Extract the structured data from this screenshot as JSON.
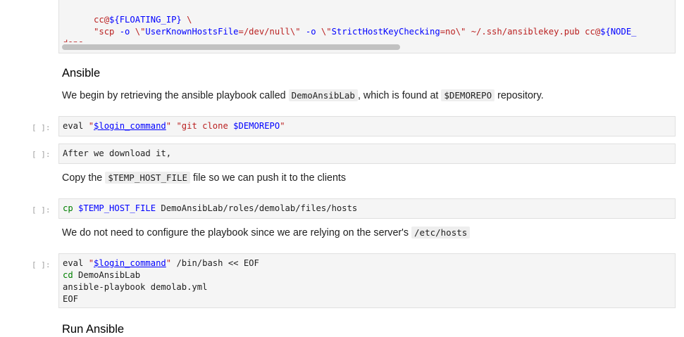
{
  "top_cell": {
    "line1_indent": "      ",
    "line1_user": "cc@",
    "line1_var": "${FLOATING_IP}",
    "line1_tail": " \\",
    "line2_indent": "      ",
    "line2_q1": "\"scp ",
    "line2_opt1": "-o",
    "line2_s1": " \\\"",
    "line2_key1": "UserKnownHostsFile",
    "line2_s2": "=/dev/null\\\" ",
    "line2_opt2": "-o",
    "line2_s3": " \\\"",
    "line2_key2": "StrictHostKeyChecking",
    "line2_s4": "=no\\\" ~/.ssh/ansiblekey.pub ",
    "line2_user": "cc@",
    "line2_var": "${NODE_",
    "line3": "done"
  },
  "ansible_heading": "Ansible",
  "ansible_text": {
    "part1": "We begin by retrieving the ansible playbook called ",
    "code1": "DemoAnsibLab",
    "part2": ", which is found at ",
    "code2": "$DEMOREPO",
    "part3": " repository."
  },
  "cell_git": {
    "prompt": "[ ]:",
    "eval": "eval ",
    "str1": "\"",
    "var1": "$login_command",
    "str2": "\"",
    "str3": " \"git clone ",
    "var2": "$DEMOREPO",
    "str4": "\""
  },
  "cell_download": {
    "prompt": "[ ]:",
    "text": "After we download it,"
  },
  "copy_text": {
    "part1": "Copy the ",
    "code1": "$TEMP_HOST_FILE",
    "part2": " file so we can push it to the clients"
  },
  "cell_cp": {
    "prompt": "[ ]:",
    "cmd": "cp",
    "var": " $TEMP_HOST_FILE",
    "rest": " DemoAnsibLab/roles/demolab/files/hosts"
  },
  "config_text": {
    "part1": "We do not need to configure the playbook since we are relying on the server's ",
    "code1": "/etc/hosts"
  },
  "cell_playbook": {
    "prompt": "[ ]:",
    "l1_eval": "eval ",
    "l1_q1": "\"",
    "l1_var": "$login_command",
    "l1_q2": "\"",
    "l1_rest": " /bin/bash << EOF",
    "l2_cmd": "cd",
    "l2_rest": " DemoAnsibLab",
    "l3": "ansible-playbook demolab.yml",
    "l4": "EOF"
  },
  "run_heading": "Run Ansible"
}
